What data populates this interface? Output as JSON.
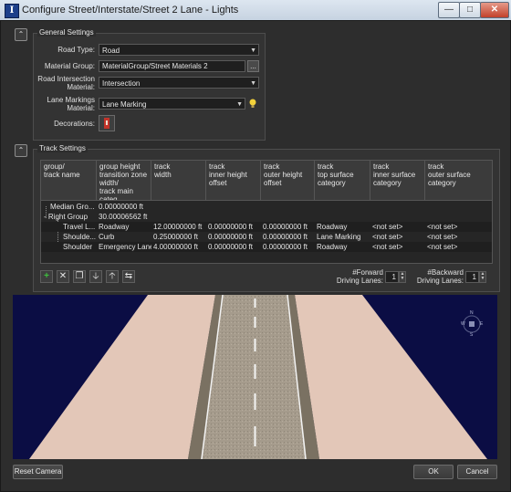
{
  "window": {
    "title": "Configure Street/Interstate/Street 2 Lane - Lights"
  },
  "general": {
    "title": "General Settings",
    "road_type_label": "Road Type:",
    "road_type_value": "Road",
    "material_group_label": "Material Group:",
    "material_group_value": "MaterialGroup/Street Materials 2",
    "browse_label": "...",
    "intersection_label_1": "Road Intersection",
    "intersection_label_2": "Material:",
    "intersection_value": "Intersection",
    "lane_markings_label_1": "Lane Markings",
    "lane_markings_label_2": "Material:",
    "lane_markings_value": "Lane Marking",
    "decorations_label": "Decorations:"
  },
  "track": {
    "title": "Track Settings",
    "columns": [
      [
        "group/",
        "track name"
      ],
      [
        "group height",
        "transition zone",
        "width/",
        "track main categ"
      ],
      [
        "track",
        "width"
      ],
      [
        "track",
        "inner height",
        "offset"
      ],
      [
        "track",
        "outer height",
        "offset"
      ],
      [
        "track",
        "top surface",
        "category"
      ],
      [
        "track",
        "inner surface",
        "category"
      ],
      [
        "track",
        "outer surface",
        "category"
      ]
    ],
    "rows": [
      {
        "name": "Median Gro...",
        "col1": "0.00000000 ft",
        "col2": "",
        "col3": "",
        "col4": "",
        "col5": "",
        "col6": "",
        "col7": ""
      },
      {
        "name": "Right Group",
        "col1": "30.00006562 ft",
        "col2": "",
        "col3": "",
        "col4": "",
        "col5": "",
        "col6": "",
        "col7": ""
      },
      {
        "name": "Travel L...",
        "col1": "Roadway",
        "col2": "12.00000000 ft",
        "col3": "0.00000000 ft",
        "col4": "0.00000000 ft",
        "col5": "Roadway",
        "col6": "<not set>",
        "col7": "<not set>"
      },
      {
        "name": "Shoulde...",
        "col1": "Curb",
        "col2": "0.25000000 ft",
        "col3": "0.00000000 ft",
        "col4": "0.00000000 ft",
        "col5": "Lane Marking",
        "col6": "<not set>",
        "col7": "<not set>"
      },
      {
        "name": "Shoulder",
        "col1": "Emergency Lane",
        "col2": "4.00000000 ft",
        "col3": "0.00000000 ft",
        "col4": "0.00000000 ft",
        "col5": "Roadway",
        "col6": "<not set>",
        "col7": "<not set>"
      }
    ],
    "forward_label_1": "#Forward",
    "forward_label_2": "Driving Lanes:",
    "forward_value": "1",
    "backward_label_1": "#Backward",
    "backward_label_2": "Driving Lanes:",
    "backward_value": "1"
  },
  "compass": {
    "n": "N",
    "s": "S",
    "e": "E",
    "w": "W"
  },
  "buttons": {
    "reset_camera": "Reset Camera",
    "ok": "OK",
    "cancel": "Cancel"
  },
  "colors": {
    "sky": "#0b0d44",
    "sidewalk": "#e3c7b8",
    "asphalt": "#a59b8c",
    "accent_add": "#3fbf3f"
  }
}
